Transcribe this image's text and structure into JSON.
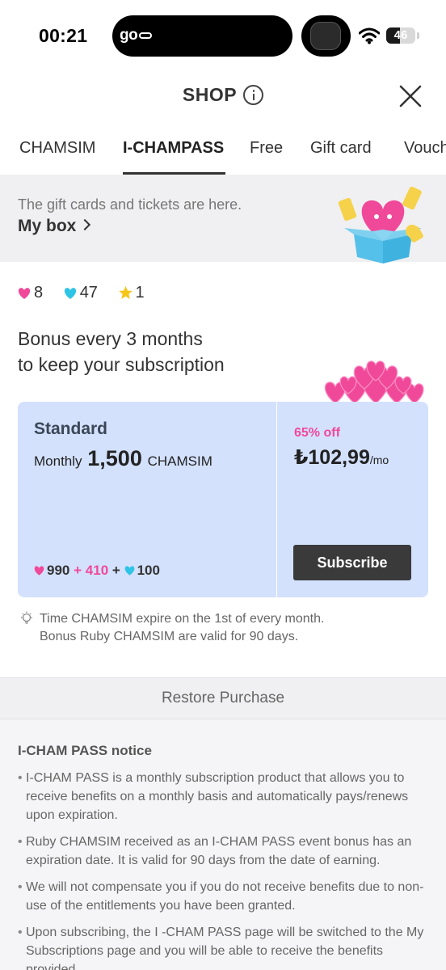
{
  "status_bar": {
    "time": "00:21",
    "app_logo": "go",
    "battery": "46",
    "battery_level": 0.46
  },
  "header": {
    "title": "SHOP"
  },
  "tabs": [
    {
      "label": "CHAMSIM"
    },
    {
      "label": "I-CHAMPASS",
      "active": true
    },
    {
      "label": "Free"
    },
    {
      "label": "Gift card"
    },
    {
      "label": "Vouch"
    }
  ],
  "my_box": {
    "description": "The gift cards and tickets are here.",
    "link": "My box"
  },
  "counts": [
    {
      "icon": "pink-heart-icon",
      "color": "#f0499a",
      "value": "8"
    },
    {
      "icon": "cyan-heart-icon",
      "color": "#2ec4e6",
      "value": "47"
    },
    {
      "icon": "star-icon",
      "color": "#f5c518",
      "value": "1"
    }
  ],
  "bonus": {
    "line1": "Bonus every 3 months",
    "line2": "to keep your subscription"
  },
  "plan": {
    "name": "Standard",
    "prefix": "Monthly",
    "amount": "1,500",
    "unit": "CHAMSIM",
    "breakdown": {
      "pink_value": "990",
      "plus1": "+",
      "bonus_value": "410",
      "plus2": "+",
      "cyan_value": "100"
    },
    "discount": "65% off",
    "price": "₺102,99",
    "per": "/mo",
    "subscribe_label": "Subscribe"
  },
  "note": {
    "line1": "Time CHAMSIM expire on the 1st of every month.",
    "line2": "Bonus Ruby CHAMSIM are valid for 90 days."
  },
  "restore_label": "Restore Purchase",
  "notice": {
    "title": "I-CHAM PASS notice",
    "items": [
      "I-CHAM PASS is a monthly subscription product that allows you to receive benefits on a monthly basis and automatically pays/renews upon expiration.",
      "Ruby CHAMSIM received as an I-CHAM PASS event bonus has an expiration date. It is valid for 90 days from the date of earning.",
      "We will not compensate you if you do not receive benefits due to non-use of the entitlements you have been granted.",
      "Upon subscribing, the I -CHAM PASS page will be switched to the My Subscriptions page and you will be able to receive the benefits provided."
    ]
  },
  "colors": {
    "accent_pink": "#f0499a",
    "card_bg": "#d3e1fd",
    "button_dark": "#3a3a3a"
  }
}
